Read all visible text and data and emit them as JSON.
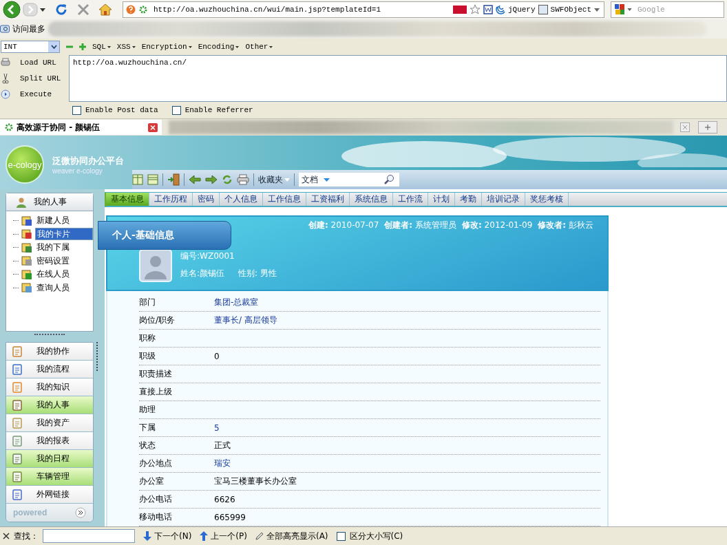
{
  "browser": {
    "url": "http://oa.wuzhouchina.cn/wui/main.jsp?templateId=1",
    "addons": [
      "jQuery",
      "SWFObject"
    ],
    "search_placeholder": "Google",
    "bookmarks_label": "访问最多",
    "hackbar": {
      "select": "INT",
      "menus": [
        "SQL",
        "XSS",
        "Encryption",
        "Encoding",
        "Other"
      ],
      "actions": [
        "Load URL",
        "Split URL",
        "Execute"
      ],
      "url_value": "http://oa.wuzhouchina.cn/",
      "options": [
        {
          "label": "Enable Post data",
          "checked": false
        },
        {
          "label": "Enable Referrer",
          "checked": false
        }
      ]
    },
    "tabs": [
      {
        "title": "高效源于协同 - 颜锡伍",
        "selected": true
      }
    ]
  },
  "app": {
    "logo": "e-cology",
    "title": "泛微协同办公平台",
    "subtitle": "weaver e-cology",
    "favorites": "收藏夹",
    "search_scope": "文档",
    "sidebar": {
      "section_title": "我的人事",
      "tree": [
        {
          "label": "新建人员",
          "selected": false
        },
        {
          "label": "我的卡片",
          "selected": true
        },
        {
          "label": "我的下属",
          "selected": false
        },
        {
          "label": "密码设置",
          "selected": false
        },
        {
          "label": "在线人员",
          "selected": false
        },
        {
          "label": "查询人员",
          "selected": false
        }
      ],
      "modules": [
        {
          "label": "我的协作",
          "highlighted": false
        },
        {
          "label": "我的流程",
          "highlighted": false
        },
        {
          "label": "我的知识",
          "highlighted": false
        },
        {
          "label": "我的人事",
          "highlighted": true
        },
        {
          "label": "我的资产",
          "highlighted": false
        },
        {
          "label": "我的报表",
          "highlighted": false
        },
        {
          "label": "我的日程",
          "highlighted": true
        },
        {
          "label": "车辆管理",
          "highlighted": true
        },
        {
          "label": "外网链接",
          "highlighted": false
        }
      ],
      "footer": "powered"
    },
    "tabs": [
      {
        "label": "基本信息",
        "selected": true
      },
      {
        "label": "工作历程",
        "selected": false
      },
      {
        "label": "密码",
        "selected": false
      },
      {
        "label": "个人信息",
        "selected": false
      },
      {
        "label": "工作信息",
        "selected": false
      },
      {
        "label": "工资福利",
        "selected": false
      },
      {
        "label": "系统信息",
        "selected": false
      },
      {
        "label": "工作流",
        "selected": false
      },
      {
        "label": "计划",
        "selected": false
      },
      {
        "label": "考勤",
        "selected": false
      },
      {
        "label": "培训记录",
        "selected": false
      },
      {
        "label": "奖惩考核",
        "selected": false
      }
    ],
    "card": {
      "title": "个人-基础信息",
      "meta": [
        {
          "label": "创建:",
          "value": "2010-07-07"
        },
        {
          "label": "创建者:",
          "value": "系统管理员"
        },
        {
          "label": "修改:",
          "value": "2012-01-09"
        },
        {
          "label": "修改者:",
          "value": "彭秋云"
        }
      ],
      "id_line": "编号:WZ0001",
      "name_line": "姓名:颜锡伍",
      "gender_line": "性别: 男性"
    },
    "fields": [
      {
        "label": "部门",
        "value": "集团-总裁室",
        "link": true
      },
      {
        "label": "岗位/职务",
        "value": "董事长/ 高层领导",
        "link": true
      },
      {
        "label": "职称"
      },
      {
        "label": "职级",
        "value": "0",
        "link": false
      },
      {
        "label": "职责描述"
      },
      {
        "label": "直接上级"
      },
      {
        "label": "助理"
      },
      {
        "label": "下属",
        "value": "5",
        "link": true
      },
      {
        "label": "状态",
        "value": "正式",
        "link": false
      },
      {
        "label": "办公地点",
        "value": "瑞安",
        "link": true
      },
      {
        "label": "办公室",
        "value": "宝马三楼董事长办公室",
        "link": false
      },
      {
        "label": "办公电话",
        "value": "6626",
        "link": false
      },
      {
        "label": "移动电话",
        "value": "665999",
        "link": false
      }
    ]
  },
  "find_bar": {
    "label": "查找：",
    "next": "下一个(N)",
    "prev": "上一个(P)",
    "highlight": "全部高亮显示(A)",
    "match_case": {
      "label": "区分大小写(C)",
      "checked": false
    }
  }
}
